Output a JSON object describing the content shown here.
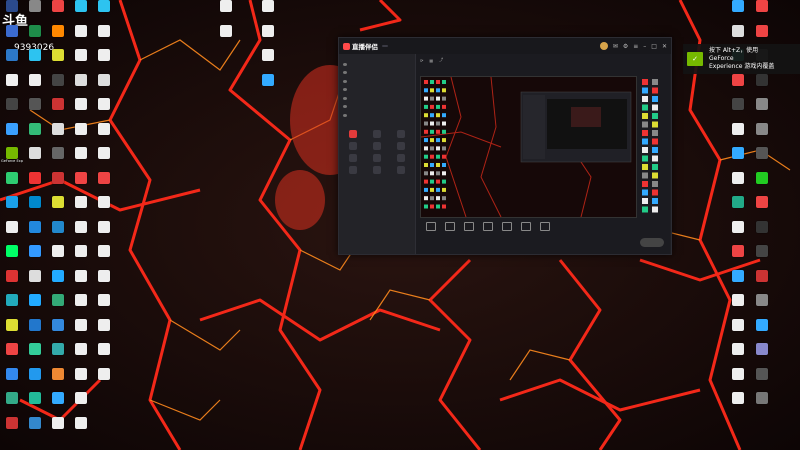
{
  "watermark": {
    "logo": "斗鱼",
    "room_id": "9393026"
  },
  "notification": {
    "text_line1": "按下 Alt+Z，使用",
    "text_line2": "GeForce",
    "text_line3": "Experience 游戏内覆盖"
  },
  "desktop": {
    "col1": [
      {
        "label": "",
        "icon": "app-icon",
        "color": "#2b4a8c",
        "glyph": ""
      },
      {
        "label": "",
        "icon": "app-icon",
        "color": "#3b6bd0",
        "glyph": ""
      },
      {
        "label": "",
        "icon": "app-icon",
        "color": "#2c78c8",
        "glyph": ""
      },
      {
        "label": "",
        "icon": "app-icon",
        "color": "#f0f0f0",
        "glyph": ""
      },
      {
        "label": "",
        "icon": "app-icon",
        "color": "#444",
        "glyph": ""
      },
      {
        "label": "",
        "icon": "app-icon",
        "color": "#3aa0ff",
        "glyph": ""
      },
      {
        "label": "GeForce Experience",
        "icon": "geforce-icon",
        "color": "#76b900",
        "glyph": ""
      },
      {
        "label": "",
        "icon": "app-icon",
        "color": "#2ecc71",
        "glyph": ""
      },
      {
        "label": "",
        "icon": "app-icon",
        "color": "#1aa0e8",
        "glyph": ""
      },
      {
        "label": "",
        "icon": "app-icon",
        "color": "#eee",
        "glyph": ""
      },
      {
        "label": "",
        "icon": "app-icon",
        "color": "#0f6",
        "glyph": ""
      },
      {
        "label": "",
        "icon": "app-icon",
        "color": "#d33",
        "glyph": ""
      },
      {
        "label": "",
        "icon": "app-icon",
        "color": "#2ab",
        "glyph": ""
      },
      {
        "label": "",
        "icon": "app-icon",
        "color": "#dd3",
        "glyph": ""
      },
      {
        "label": "",
        "icon": "app-icon",
        "color": "#e44",
        "glyph": ""
      },
      {
        "label": "",
        "icon": "app-icon",
        "color": "#38e",
        "glyph": ""
      },
      {
        "label": "",
        "icon": "app-icon",
        "color": "#3a8",
        "glyph": ""
      },
      {
        "label": "",
        "icon": "app-icon",
        "color": "#c33",
        "glyph": ""
      }
    ],
    "col2": [
      {
        "label": "",
        "icon": "app-icon",
        "color": "#888",
        "glyph": ""
      },
      {
        "label": "",
        "icon": "app-icon",
        "color": "#1e8c4a",
        "glyph": ""
      },
      {
        "label": "",
        "icon": "app-icon",
        "color": "#2dc3f0",
        "glyph": ""
      },
      {
        "label": "",
        "icon": "app-icon",
        "color": "#eee",
        "glyph": ""
      },
      {
        "label": "",
        "icon": "app-icon",
        "color": "#555",
        "glyph": ""
      },
      {
        "label": "",
        "icon": "app-icon",
        "color": "#3b7",
        "glyph": ""
      },
      {
        "label": "",
        "icon": "app-icon",
        "color": "#ddd",
        "glyph": ""
      },
      {
        "label": "",
        "icon": "app-icon",
        "color": "#e33",
        "glyph": ""
      },
      {
        "label": "",
        "icon": "app-icon",
        "color": "#08c",
        "glyph": ""
      },
      {
        "label": "",
        "icon": "app-icon",
        "color": "#28d",
        "glyph": ""
      },
      {
        "label": "",
        "icon": "app-icon",
        "color": "#39f",
        "glyph": ""
      },
      {
        "label": "",
        "icon": "app-icon",
        "color": "#ddd",
        "glyph": ""
      },
      {
        "label": "",
        "icon": "app-icon",
        "color": "#2af",
        "glyph": ""
      },
      {
        "label": "",
        "icon": "app-icon",
        "color": "#27c",
        "glyph": ""
      },
      {
        "label": "",
        "icon": "app-icon",
        "color": "#3c9",
        "glyph": ""
      },
      {
        "label": "",
        "icon": "app-icon",
        "color": "#29e",
        "glyph": ""
      },
      {
        "label": "",
        "icon": "app-icon",
        "color": "#2b9",
        "glyph": ""
      },
      {
        "label": "",
        "icon": "app-icon",
        "color": "#38c",
        "glyph": ""
      }
    ],
    "col3": [
      {
        "label": "",
        "icon": "app-icon",
        "color": "#e44",
        "glyph": ""
      },
      {
        "label": "",
        "icon": "app-icon",
        "color": "#f80",
        "glyph": ""
      },
      {
        "label": "",
        "icon": "app-icon",
        "color": "#dd3",
        "glyph": ""
      },
      {
        "label": "",
        "icon": "app-icon",
        "color": "#444",
        "glyph": ""
      },
      {
        "label": "",
        "icon": "app-icon",
        "color": "#c33",
        "glyph": ""
      },
      {
        "label": "",
        "icon": "app-icon",
        "color": "#ddd",
        "glyph": ""
      },
      {
        "label": "",
        "icon": "app-icon",
        "color": "#666",
        "glyph": ""
      },
      {
        "label": "",
        "icon": "app-icon",
        "color": "#c33",
        "glyph": ""
      },
      {
        "label": "",
        "icon": "app-icon",
        "color": "#dd3",
        "glyph": ""
      },
      {
        "label": "",
        "icon": "app-icon",
        "color": "#28c",
        "glyph": ""
      },
      {
        "label": "",
        "icon": "app-icon",
        "color": "#eee",
        "glyph": ""
      },
      {
        "label": "",
        "icon": "app-icon",
        "color": "#2af",
        "glyph": ""
      },
      {
        "label": "",
        "icon": "app-icon",
        "color": "#3a7",
        "glyph": ""
      },
      {
        "label": "",
        "icon": "app-icon",
        "color": "#38d",
        "glyph": ""
      },
      {
        "label": "",
        "icon": "app-icon",
        "color": "#3aa",
        "glyph": ""
      },
      {
        "label": "",
        "icon": "app-icon",
        "color": "#e83",
        "glyph": ""
      },
      {
        "label": "",
        "icon": "app-icon",
        "color": "#3af",
        "glyph": ""
      },
      {
        "label": "",
        "icon": "app-icon",
        "color": "#eee",
        "glyph": ""
      }
    ],
    "col4": [
      {
        "label": "",
        "icon": "app-icon",
        "color": "#2dc3f0",
        "glyph": ""
      },
      {
        "label": "",
        "icon": "app-icon",
        "color": "#eee",
        "glyph": ""
      },
      {
        "label": "",
        "icon": "app-icon",
        "color": "#eee",
        "glyph": ""
      },
      {
        "label": "",
        "icon": "app-icon",
        "color": "#ddd",
        "glyph": ""
      },
      {
        "label": "",
        "icon": "app-icon",
        "color": "#eee",
        "glyph": ""
      },
      {
        "label": "",
        "icon": "app-icon",
        "color": "#eee",
        "glyph": ""
      },
      {
        "label": "",
        "icon": "app-icon",
        "color": "#eee",
        "glyph": ""
      },
      {
        "label": "",
        "icon": "app-icon",
        "color": "#e44",
        "glyph": ""
      },
      {
        "label": "",
        "icon": "app-icon",
        "color": "#eee",
        "glyph": ""
      },
      {
        "label": "",
        "icon": "app-icon",
        "color": "#eee",
        "glyph": ""
      },
      {
        "label": "",
        "icon": "app-icon",
        "color": "#eee",
        "glyph": ""
      },
      {
        "label": "",
        "icon": "app-icon",
        "color": "#eee",
        "glyph": ""
      },
      {
        "label": "",
        "icon": "app-icon",
        "color": "#eee",
        "glyph": ""
      },
      {
        "label": "",
        "icon": "app-icon",
        "color": "#eee",
        "glyph": ""
      },
      {
        "label": "",
        "icon": "app-icon",
        "color": "#eee",
        "glyph": ""
      },
      {
        "label": "",
        "icon": "app-icon",
        "color": "#eee",
        "glyph": ""
      },
      {
        "label": "",
        "icon": "app-icon",
        "color": "#eee",
        "glyph": ""
      },
      {
        "label": "",
        "icon": "app-icon",
        "color": "#eee",
        "glyph": ""
      }
    ],
    "col_mid1": [
      {
        "label": "",
        "icon": "app-icon",
        "color": "#eee",
        "glyph": ""
      },
      {
        "label": "",
        "icon": "app-icon",
        "color": "#eee",
        "glyph": ""
      }
    ],
    "col_mid2": [
      {
        "label": "",
        "icon": "app-icon",
        "color": "#eee",
        "glyph": ""
      },
      {
        "label": "",
        "icon": "app-icon",
        "color": "#eee",
        "glyph": ""
      },
      {
        "label": "",
        "icon": "app-icon",
        "color": "#eee",
        "glyph": ""
      },
      {
        "label": "",
        "icon": "app-icon",
        "color": "#3af",
        "glyph": ""
      }
    ],
    "right1": [
      {
        "label": "",
        "icon": "app-icon",
        "color": "#3af",
        "glyph": ""
      },
      {
        "label": "",
        "icon": "app-icon",
        "color": "#ddd",
        "glyph": ""
      },
      {
        "label": "",
        "icon": "app-icon",
        "color": "#2a8",
        "glyph": ""
      },
      {
        "label": "",
        "icon": "app-icon",
        "color": "#e44",
        "glyph": ""
      },
      {
        "label": "",
        "icon": "app-icon",
        "color": "#444",
        "glyph": ""
      },
      {
        "label": "",
        "icon": "app-icon",
        "color": "#eee",
        "glyph": ""
      },
      {
        "label": "",
        "icon": "app-icon",
        "color": "#3af",
        "glyph": ""
      },
      {
        "label": "",
        "icon": "app-icon",
        "color": "#eee",
        "glyph": ""
      },
      {
        "label": "",
        "icon": "app-icon",
        "color": "#2a8",
        "glyph": ""
      },
      {
        "label": "",
        "icon": "app-icon",
        "color": "#eee",
        "glyph": ""
      },
      {
        "label": "",
        "icon": "app-icon",
        "color": "#e44",
        "glyph": ""
      },
      {
        "label": "",
        "icon": "app-icon",
        "color": "#3af",
        "glyph": ""
      },
      {
        "label": "",
        "icon": "app-icon",
        "color": "#eee",
        "glyph": ""
      },
      {
        "label": "",
        "icon": "app-icon",
        "color": "#eee",
        "glyph": ""
      },
      {
        "label": "",
        "icon": "app-icon",
        "color": "#eee",
        "glyph": ""
      },
      {
        "label": "",
        "icon": "app-icon",
        "color": "#eee",
        "glyph": ""
      },
      {
        "label": "",
        "icon": "app-icon",
        "color": "#eee",
        "glyph": ""
      }
    ],
    "right2": [
      {
        "label": "",
        "icon": "app-icon",
        "color": "#e44",
        "glyph": ""
      },
      {
        "label": "",
        "icon": "app-icon",
        "color": "#e44",
        "glyph": ""
      },
      {
        "label": "",
        "icon": "app-icon",
        "color": "#555",
        "glyph": ""
      },
      {
        "label": "",
        "icon": "app-icon",
        "color": "#333",
        "glyph": ""
      },
      {
        "label": "",
        "icon": "app-icon",
        "color": "#888",
        "glyph": ""
      },
      {
        "label": "",
        "icon": "app-icon",
        "color": "#888",
        "glyph": ""
      },
      {
        "label": "",
        "icon": "app-icon",
        "color": "#555",
        "glyph": ""
      },
      {
        "label": "",
        "icon": "app-icon",
        "color": "#2c2",
        "glyph": ""
      },
      {
        "label": "",
        "icon": "app-icon",
        "color": "#e44",
        "glyph": ""
      },
      {
        "label": "",
        "icon": "app-icon",
        "color": "#333",
        "glyph": ""
      },
      {
        "label": "",
        "icon": "app-icon",
        "color": "#444",
        "glyph": ""
      },
      {
        "label": "",
        "icon": "app-icon",
        "color": "#c33",
        "glyph": ""
      },
      {
        "label": "",
        "icon": "app-icon",
        "color": "#888",
        "glyph": ""
      },
      {
        "label": "",
        "icon": "app-icon",
        "color": "#3af",
        "glyph": ""
      },
      {
        "label": "",
        "icon": "app-icon",
        "color": "#88c",
        "glyph": ""
      },
      {
        "label": "",
        "icon": "app-icon",
        "color": "#555",
        "glyph": ""
      },
      {
        "label": "",
        "icon": "app-icon",
        "color": "#777",
        "glyph": ""
      }
    ]
  },
  "app": {
    "title": "直播伴侣",
    "badge": "",
    "left_tabs": [
      "",
      "",
      ""
    ],
    "scenes": [
      "",
      "",
      "",
      "",
      "",
      "",
      ""
    ],
    "tools_header": "",
    "tools": [
      "",
      "",
      "",
      "",
      "",
      "",
      "",
      "",
      "",
      "",
      "",
      ""
    ],
    "bottom_tools": [
      "",
      "",
      "",
      "",
      "",
      "",
      ""
    ],
    "go_live": "",
    "status": ""
  },
  "colors": {
    "lava": "#ff2a1a",
    "lava_glow": "#ff7a1e",
    "rock": "#1a0c0a"
  }
}
